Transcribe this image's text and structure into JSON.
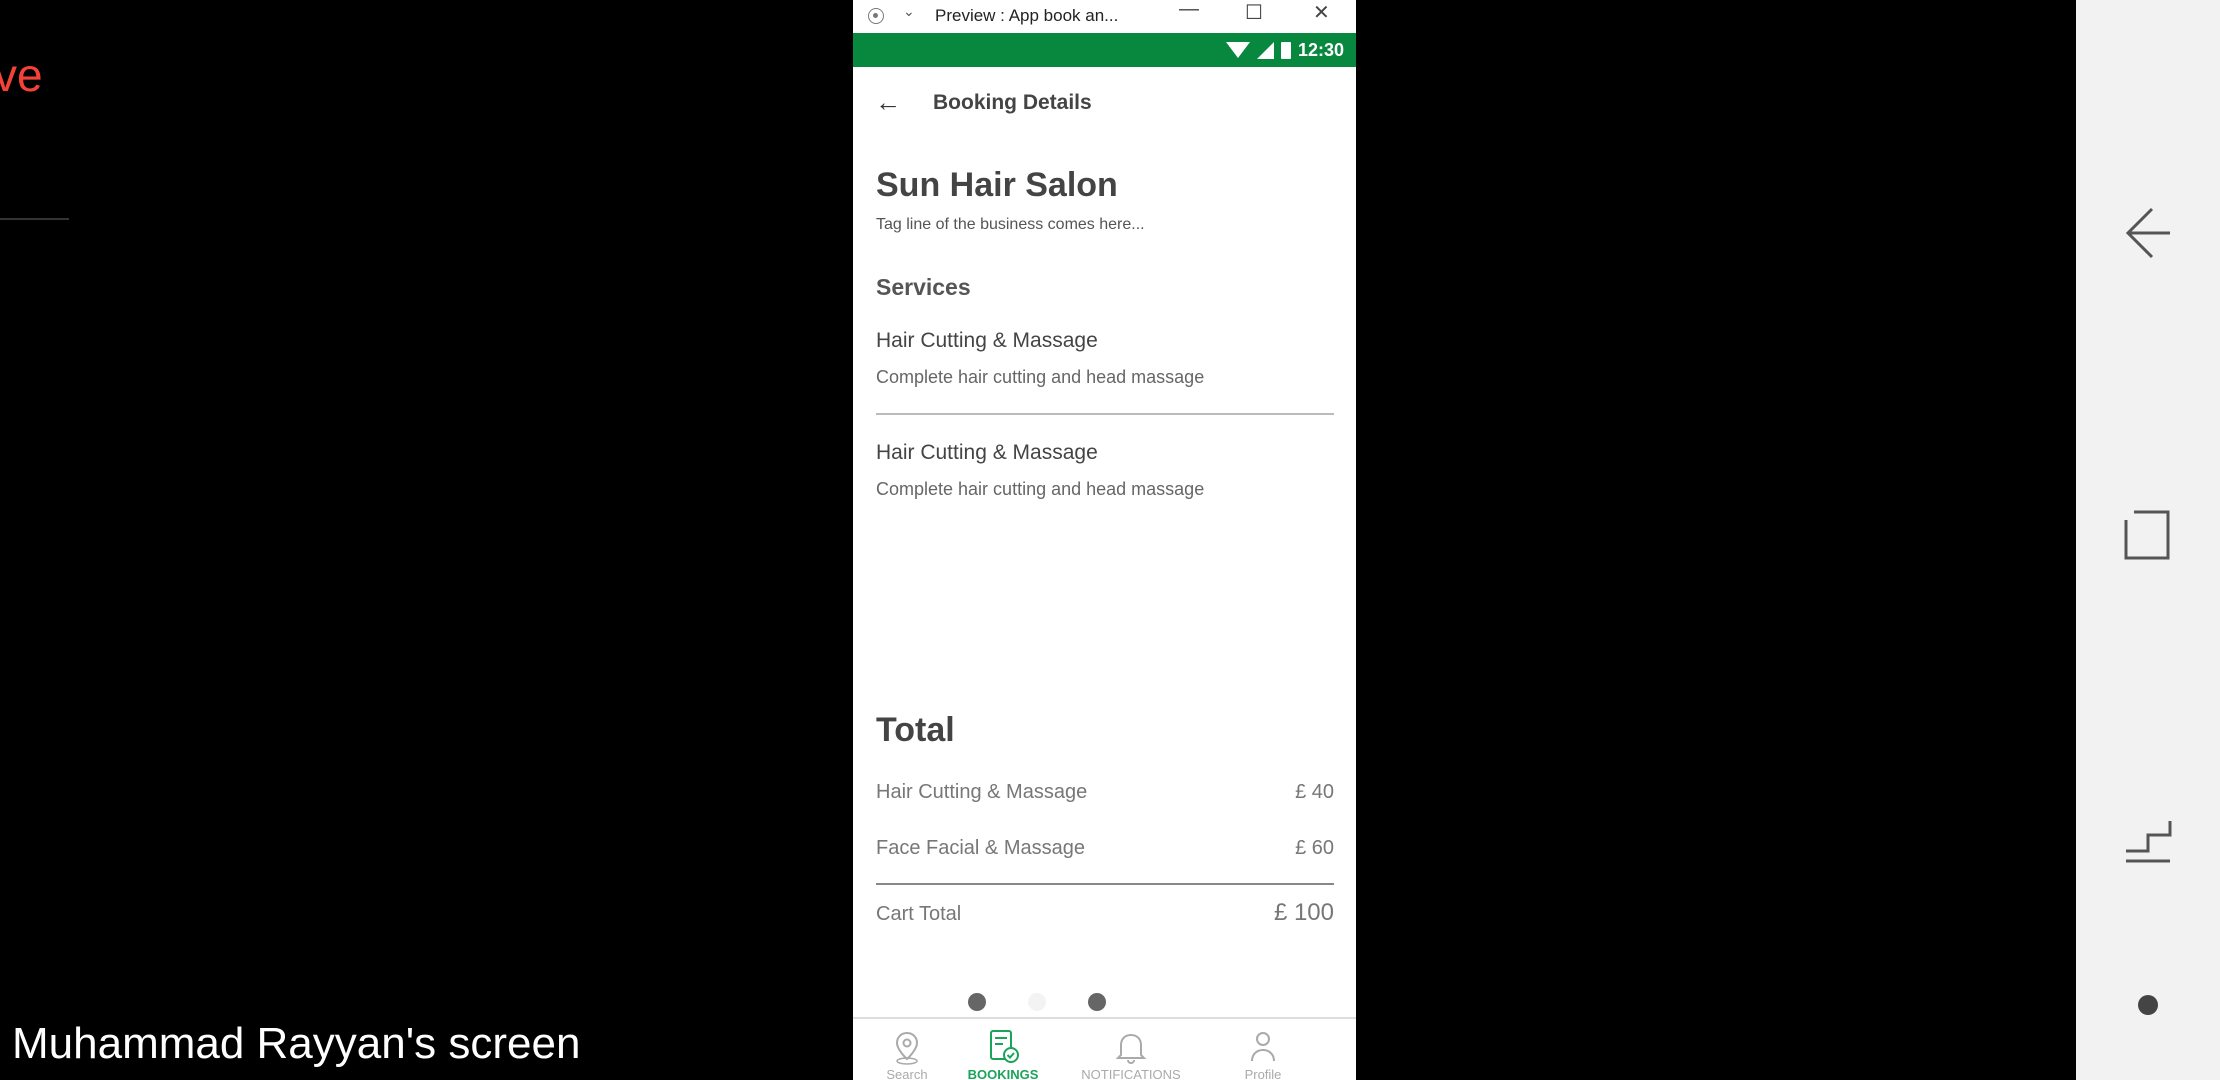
{
  "left_partial_text": "ve",
  "screen_label": "Muhammad Rayyan's screen",
  "window": {
    "title": "Preview : App book an...",
    "minimize_glyph": "—",
    "maximize_glyph": "☐",
    "close_glyph": "✕"
  },
  "statusbar": {
    "time": "12:30"
  },
  "app": {
    "header_title": "Booking Details",
    "business_name": "Sun Hair Salon",
    "business_tagline": "Tag line of the business comes here...",
    "services_heading": "Services",
    "services": [
      {
        "name": "Hair Cutting & Massage",
        "description": "Complete hair cutting and head massage"
      },
      {
        "name": "Hair Cutting & Massage",
        "description": "Complete hair cutting and head massage"
      }
    ],
    "total_heading": "Total",
    "total_items": [
      {
        "label": "Hair Cutting & Massage",
        "price": "£ 40"
      },
      {
        "label": "Face Facial & Massage",
        "price": "£ 60"
      }
    ],
    "cart_total_label": "Cart Total",
    "cart_total_value": "£ 100",
    "nav": [
      {
        "label": "Search",
        "icon": "map-pin-icon"
      },
      {
        "label": "BOOKINGS",
        "icon": "bookings-icon",
        "active": true
      },
      {
        "label": "NOTIFICATIONS",
        "icon": "bell-icon"
      },
      {
        "label": "Profile",
        "icon": "user-icon"
      }
    ]
  },
  "colors": {
    "statusbar": "#08873f",
    "active_nav": "#1aa35a",
    "left_text": "#f44336"
  }
}
